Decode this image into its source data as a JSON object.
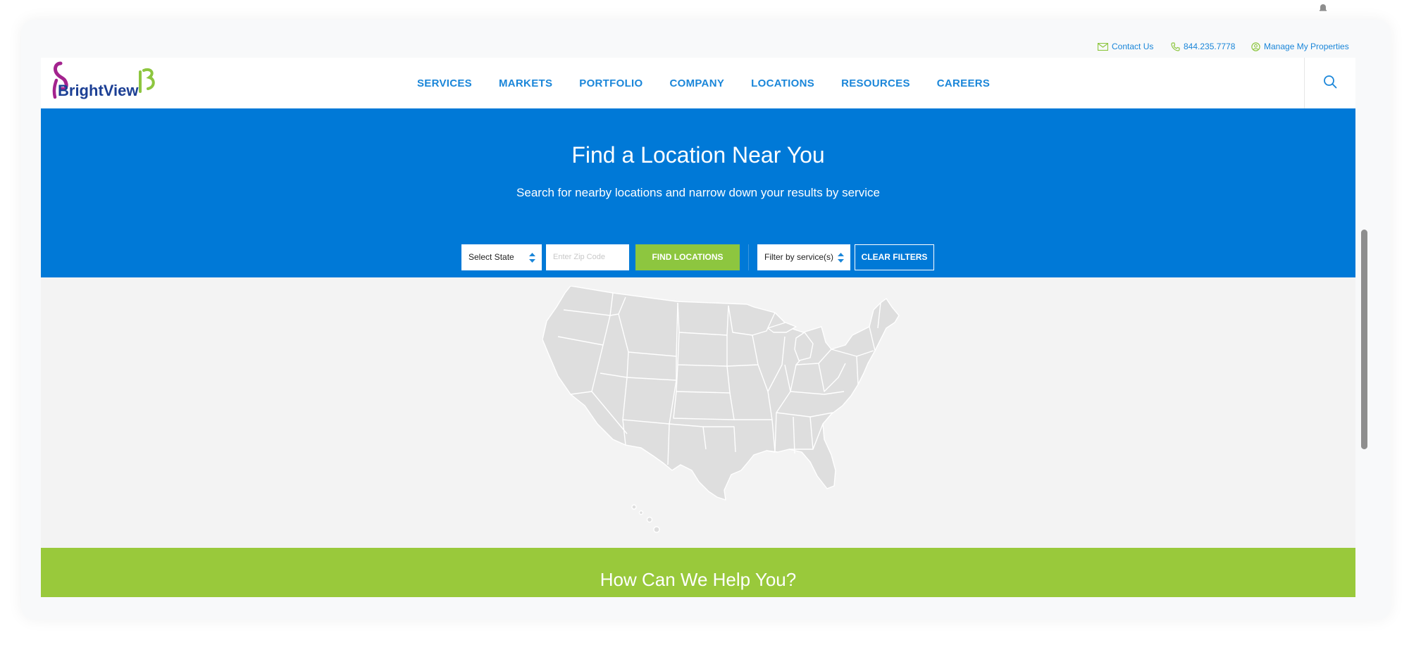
{
  "utility": {
    "contact_label": "Contact Us",
    "phone_label": "844.235.7778",
    "manage_label": "Manage My Properties"
  },
  "header": {
    "logo_text": "BrightView",
    "nav": [
      "SERVICES",
      "MARKETS",
      "PORTFOLIO",
      "COMPANY",
      "LOCATIONS",
      "RESOURCES",
      "CAREERS"
    ]
  },
  "hero": {
    "title": "Find a Location Near You",
    "subtitle": "Search for nearby locations and narrow down your results by service",
    "state_select": "Select State",
    "zip_placeholder": "Enter Zip Code",
    "find_button": "FIND LOCATIONS",
    "service_select": "Filter by service(s)",
    "clear_button": "CLEAR FILTERS"
  },
  "help": {
    "title": "How Can We Help You?"
  },
  "colors": {
    "primary_blue": "#0079d7",
    "link_blue": "#1a86d9",
    "green": "#8dc63f",
    "help_green": "#99c93b",
    "logo_purple": "#a3238e",
    "logo_navy": "#1c3f94",
    "map_fill": "#dedede",
    "map_bg": "#f3f3f3"
  },
  "icons": {
    "contact": "envelope-icon",
    "phone": "phone-icon",
    "manage": "user-circle-icon",
    "search": "search-icon",
    "select": "sort-arrows-icon",
    "bell": "bell-icon"
  }
}
